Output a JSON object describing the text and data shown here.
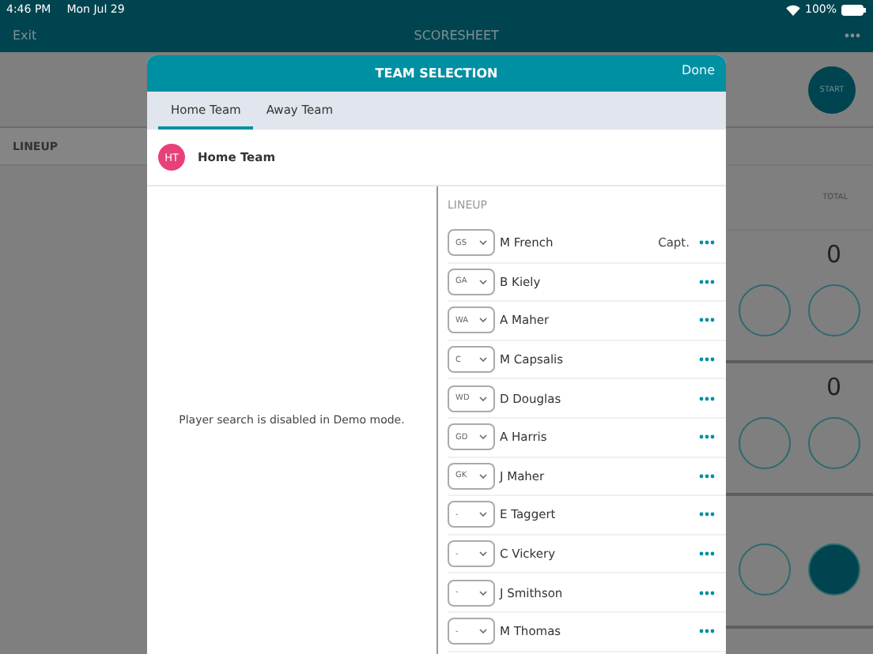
{
  "status_bar": {
    "time": "4:46 PM",
    "date": "Mon Jul 29",
    "battery": "100%"
  },
  "nav": {
    "exit": "Exit",
    "title": "SCORESHEET"
  },
  "background": {
    "lineup_label": "LINEUP",
    "start": "START",
    "total_label": "TOTAL",
    "scores": [
      "0",
      "0"
    ],
    "circle_rows": [
      {
        "circles": [
          {
            "filled": false
          },
          {
            "filled": false
          }
        ]
      },
      {
        "circles": [
          {
            "filled": false
          },
          {
            "filled": false
          }
        ]
      },
      {
        "circles": [
          {
            "filled": false
          },
          {
            "filled": true
          }
        ]
      }
    ]
  },
  "modal": {
    "title": "TEAM SELECTION",
    "done": "Done",
    "tabs": [
      {
        "label": "Home Team",
        "selected": true
      },
      {
        "label": "Away Team",
        "selected": false
      }
    ],
    "team": {
      "initials": "HT",
      "name": "Home Team",
      "color": "#e8407a"
    },
    "search_notice": "Player search is disabled in Demo mode.",
    "lineup_label": "LINEUP",
    "players": [
      {
        "position": "GS",
        "name": "M French",
        "tag": "Capt."
      },
      {
        "position": "GA",
        "name": "B Kiely"
      },
      {
        "position": "WA",
        "name": "A Maher"
      },
      {
        "position": "C",
        "name": "M Capsalis"
      },
      {
        "position": "WD",
        "name": "D Douglas"
      },
      {
        "position": "GD",
        "name": "A Harris"
      },
      {
        "position": "GK",
        "name": "J Maher"
      },
      {
        "position": "-",
        "name": "E Taggert"
      },
      {
        "position": "-",
        "name": "C Vickery"
      },
      {
        "position": "-",
        "name": "J Smithson"
      },
      {
        "position": "-",
        "name": "M Thomas"
      }
    ]
  }
}
